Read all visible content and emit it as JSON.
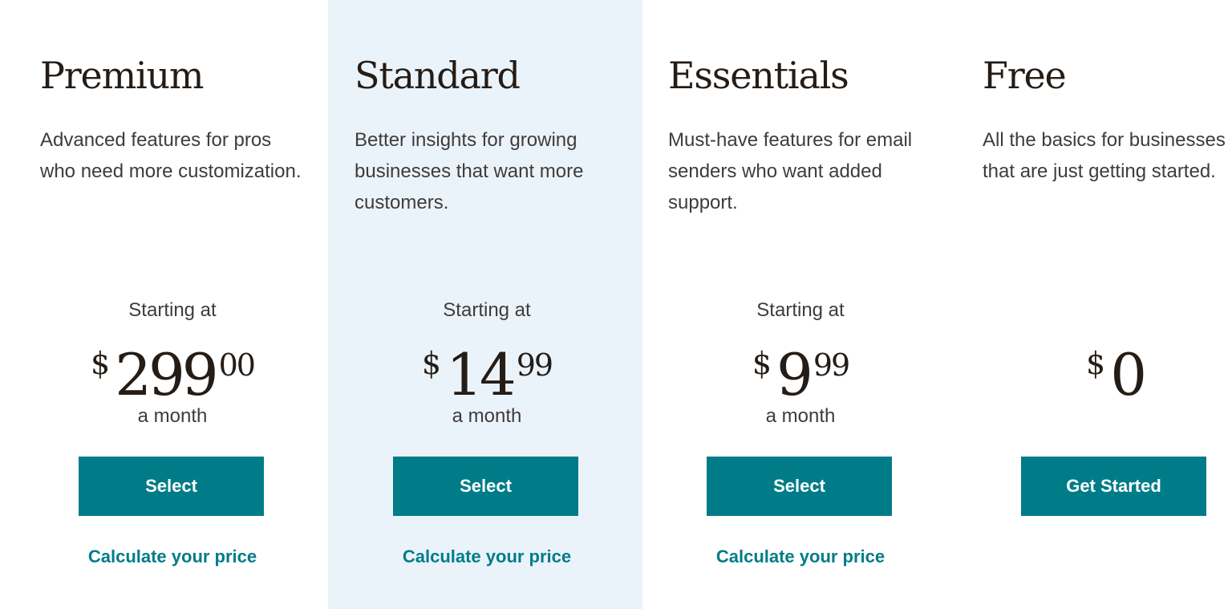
{
  "theme": {
    "accent": "#007c89",
    "featured_bg": "#ebf3fa",
    "heading_color": "#241c15",
    "body_color": "#403b3b"
  },
  "plans": [
    {
      "name": "Premium",
      "description": "Advanced features for pros who need more customization.",
      "starting_label": "Starting at",
      "currency": "$",
      "amount": "299",
      "cents": "00",
      "period": "a month",
      "cta_label": "Select",
      "calc_link": "Calculate your price",
      "featured": false
    },
    {
      "name": "Standard",
      "description": "Better insights for growing businesses that want more customers.",
      "starting_label": "Starting at",
      "currency": "$",
      "amount": "14",
      "cents": "99",
      "period": "a month",
      "cta_label": "Select",
      "calc_link": "Calculate your price",
      "featured": true
    },
    {
      "name": "Essentials",
      "description": "Must-have features for email senders who want added support.",
      "starting_label": "Starting at",
      "currency": "$",
      "amount": "9",
      "cents": "99",
      "period": "a month",
      "cta_label": "Select",
      "calc_link": "Calculate your price",
      "featured": false
    },
    {
      "name": "Free",
      "description": "All the basics for businesses that are just getting started.",
      "currency": "$",
      "amount": "0",
      "cta_label": "Get Started",
      "featured": false
    }
  ]
}
